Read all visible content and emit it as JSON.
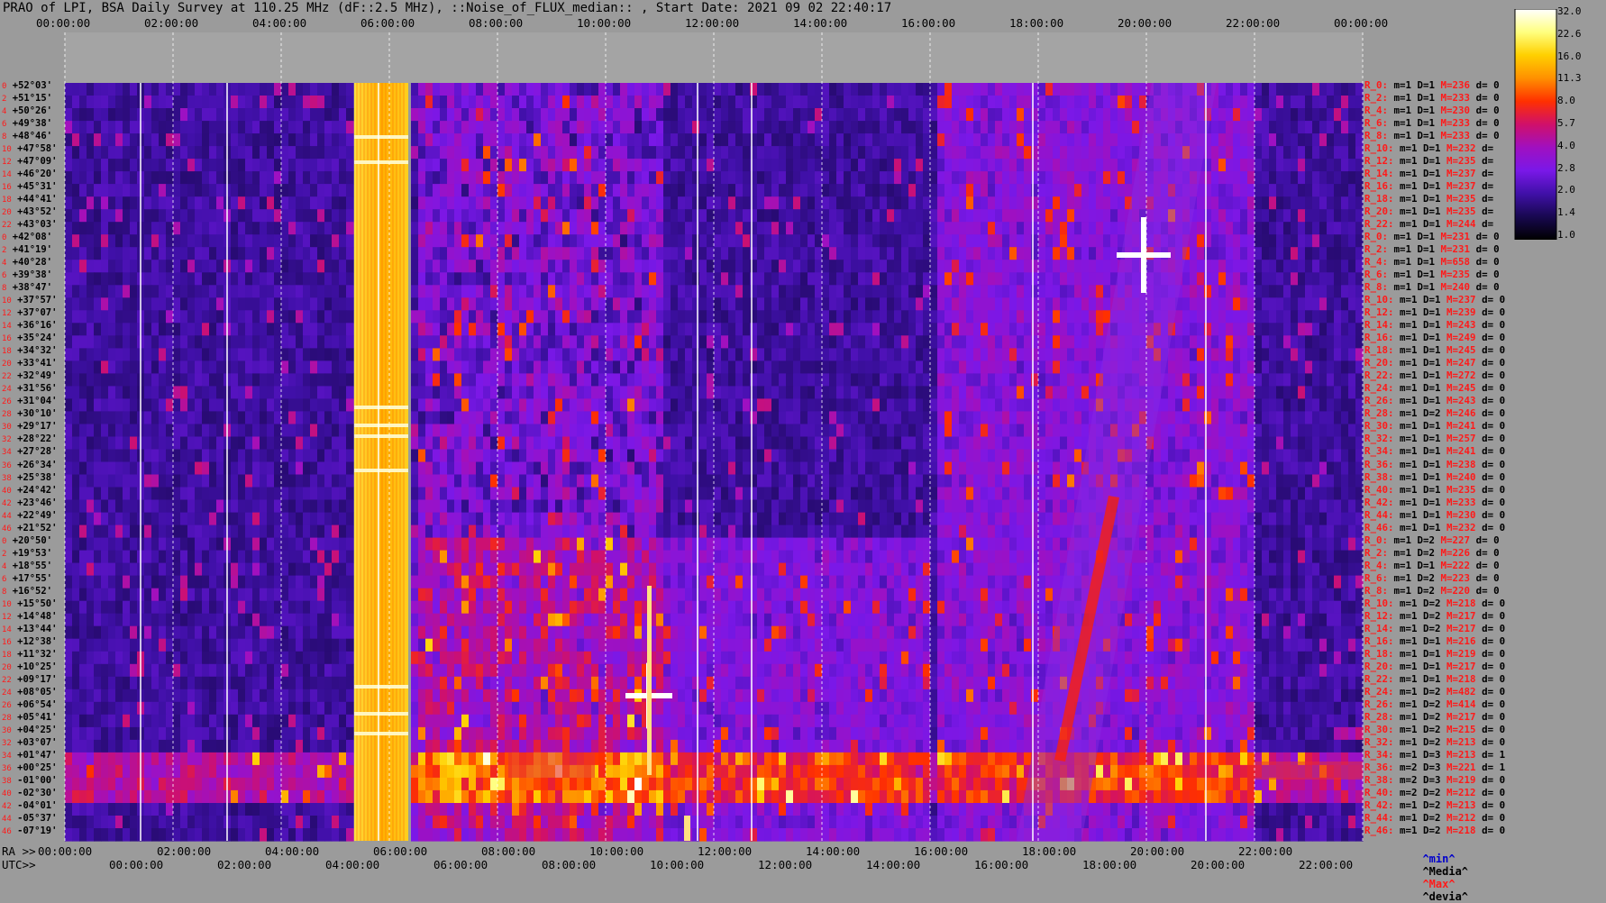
{
  "title": "PRAO of LPI, BSA Daily Survey at 110.25 MHz (dF::2.5 MHz), ::Noise_of_FLUX_median:: , Start Date: 2021 09 02 22:40:17",
  "top_axis": [
    "00:00:00",
    "02:00:00",
    "04:00:00",
    "06:00:00",
    "08:00:00",
    "10:00:00",
    "12:00:00",
    "14:00:00",
    "16:00:00",
    "18:00:00",
    "20:00:00",
    "22:00:00",
    "00:00:00"
  ],
  "ra_prefix": "RA >>",
  "ra_axis": [
    "00:00:00",
    "02:00:00",
    "04:00:00",
    "06:00:00",
    "08:00:00",
    "10:00:00",
    "12:00:00",
    "14:00:00",
    "16:00:00",
    "18:00:00",
    "20:00:00",
    "22:00:00"
  ],
  "utc_prefix": "UTC>>",
  "utc_axis": [
    "00:00:00",
    "02:00:00",
    "04:00:00",
    "06:00:00",
    "08:00:00",
    "10:00:00",
    "12:00:00",
    "14:00:00",
    "16:00:00",
    "18:00:00",
    "20:00:00",
    "22:00:00"
  ],
  "colorbar": {
    "ticks": [
      "32.0",
      "22.6",
      "16.0",
      "11.3",
      "8.0",
      "5.7",
      "4.0",
      "2.8",
      "2.0",
      "1.4",
      "1.0"
    ],
    "colors": [
      "#ffffff",
      "#ffff80",
      "#ffd000",
      "#ff9000",
      "#ff3000",
      "#d0106a",
      "#a010c0",
      "#7a18e8",
      "#4010a8",
      "#180850",
      "#000000"
    ]
  },
  "legend": {
    "min": "^min^",
    "median": "^Media^",
    "max": "^Max^",
    "dev": "^devia^"
  },
  "legend_colors": {
    "min": "#0000cc",
    "median": "#000000",
    "max": "#ff1a1a",
    "dev": "#000000"
  },
  "chart_data": {
    "type": "heatmap",
    "title": "PRAO of LPI, BSA Daily Survey at 110.25 MHz (dF::2.5 MHz), ::Noise_of_FLUX_median:: , Start Date: 2021 09 02 22:40:17",
    "x_unit": "RA / UTC (hh:mm:ss)",
    "y_labels": [
      "+52°03'",
      "+51°15'",
      "+50°26'",
      "+49°38'",
      "+48°46'",
      "+47°58'",
      "+47°09'",
      "+46°20'",
      "+45°31'",
      "+44°41'",
      "+43°52'",
      "+43°03'",
      "+42°08'",
      "+41°19'",
      "+40°28'",
      "+39°38'",
      "+38°47'",
      "+37°57'",
      "+37°07'",
      "+36°16'",
      "+35°24'",
      "+34°32'",
      "+33°41'",
      "+32°49'",
      "+31°56'",
      "+31°04'",
      "+30°10'",
      "+29°17'",
      "+28°22'",
      "+27°28'",
      "+26°34'",
      "+25°38'",
      "+24°42'",
      "+23°46'",
      "+22°49'",
      "+21°52'",
      "+20°50'",
      "+19°53'",
      "+18°55'",
      "+17°55'",
      "+16°52'",
      "+15°50'",
      "+14°48'",
      "+13°44'",
      "+12°38'",
      "+11°32'",
      "+10°25'",
      "+09°17'",
      "+08°05'",
      "+06°54'",
      "+05°41'",
      "+04°25'",
      "+03°07'",
      "+01°47'",
      "+00°25'",
      "-01°00'",
      "-02°30'",
      "-04°01'",
      "-05°37'",
      "-07°19'"
    ],
    "row_numbers": [
      "0",
      "2",
      "4",
      "6",
      "8",
      "10",
      "12",
      "14",
      "16",
      "18",
      "20",
      "22",
      "0",
      "2",
      "4",
      "6",
      "8",
      "10",
      "12",
      "14",
      "16",
      "18",
      "20",
      "22",
      "24",
      "26",
      "28",
      "30",
      "32",
      "34",
      "36",
      "38",
      "40",
      "42",
      "44",
      "46",
      "0",
      "2",
      "4",
      "6",
      "8",
      "10",
      "12",
      "14",
      "16",
      "18",
      "20",
      "22",
      "24",
      "26",
      "28",
      "30",
      "32",
      "34",
      "36",
      "38",
      "40",
      "42",
      "44",
      "46"
    ],
    "colorbar_range": [
      1.0,
      32.0
    ],
    "colorbar_scale": "log"
  },
  "row_stats": [
    {
      "r": "R_0:",
      "m": "m=1",
      "D": "D=1",
      "M": "M=236",
      "d": "d= 0"
    },
    {
      "r": "R_2:",
      "m": "m=1",
      "D": "D=1",
      "M": "M=233",
      "d": "d= 0"
    },
    {
      "r": "R_4:",
      "m": "m=1",
      "D": "D=1",
      "M": "M=230",
      "d": "d= 0"
    },
    {
      "r": "R_6:",
      "m": "m=1",
      "D": "D=1",
      "M": "M=233",
      "d": "d= 0"
    },
    {
      "r": "R_8:",
      "m": "m=1",
      "D": "D=1",
      "M": "M=233",
      "d": "d= 0"
    },
    {
      "r": "R_10:",
      "m": "m=1",
      "D": "D=1",
      "M": "M=232",
      "d": "d="
    },
    {
      "r": "R_12:",
      "m": "m=1",
      "D": "D=1",
      "M": "M=235",
      "d": "d="
    },
    {
      "r": "R_14:",
      "m": "m=1",
      "D": "D=1",
      "M": "M=237",
      "d": "d="
    },
    {
      "r": "R_16:",
      "m": "m=1",
      "D": "D=1",
      "M": "M=237",
      "d": "d="
    },
    {
      "r": "R_18:",
      "m": "m=1",
      "D": "D=1",
      "M": "M=235",
      "d": "d="
    },
    {
      "r": "R_20:",
      "m": "m=1",
      "D": "D=1",
      "M": "M=235",
      "d": "d="
    },
    {
      "r": "R_22:",
      "m": "m=1",
      "D": "D=1",
      "M": "M=244",
      "d": "d="
    },
    {
      "r": "R_0:",
      "m": "m=1",
      "D": "D=1",
      "M": "M=231",
      "d": "d= 0"
    },
    {
      "r": "R_2:",
      "m": "m=1",
      "D": "D=1",
      "M": "M=231",
      "d": "d= 0"
    },
    {
      "r": "R_4:",
      "m": "m=1",
      "D": "D=1",
      "M": "M=658",
      "d": "d= 0"
    },
    {
      "r": "R_6:",
      "m": "m=1",
      "D": "D=1",
      "M": "M=235",
      "d": "d= 0"
    },
    {
      "r": "R_8:",
      "m": "m=1",
      "D": "D=1",
      "M": "M=240",
      "d": "d= 0"
    },
    {
      "r": "R_10:",
      "m": "m=1",
      "D": "D=1",
      "M": "M=237",
      "d": "d= 0"
    },
    {
      "r": "R_12:",
      "m": "m=1",
      "D": "D=1",
      "M": "M=239",
      "d": "d= 0"
    },
    {
      "r": "R_14:",
      "m": "m=1",
      "D": "D=1",
      "M": "M=243",
      "d": "d= 0"
    },
    {
      "r": "R_16:",
      "m": "m=1",
      "D": "D=1",
      "M": "M=249",
      "d": "d= 0"
    },
    {
      "r": "R_18:",
      "m": "m=1",
      "D": "D=1",
      "M": "M=245",
      "d": "d= 0"
    },
    {
      "r": "R_20:",
      "m": "m=1",
      "D": "D=1",
      "M": "M=247",
      "d": "d= 0"
    },
    {
      "r": "R_22:",
      "m": "m=1",
      "D": "D=1",
      "M": "M=272",
      "d": "d= 0"
    },
    {
      "r": "R_24:",
      "m": "m=1",
      "D": "D=1",
      "M": "M=245",
      "d": "d= 0"
    },
    {
      "r": "R_26:",
      "m": "m=1",
      "D": "D=1",
      "M": "M=243",
      "d": "d= 0"
    },
    {
      "r": "R_28:",
      "m": "m=1",
      "D": "D=2",
      "M": "M=246",
      "d": "d= 0"
    },
    {
      "r": "R_30:",
      "m": "m=1",
      "D": "D=1",
      "M": "M=241",
      "d": "d= 0"
    },
    {
      "r": "R_32:",
      "m": "m=1",
      "D": "D=1",
      "M": "M=257",
      "d": "d= 0"
    },
    {
      "r": "R_34:",
      "m": "m=1",
      "D": "D=1",
      "M": "M=241",
      "d": "d= 0"
    },
    {
      "r": "R_36:",
      "m": "m=1",
      "D": "D=1",
      "M": "M=238",
      "d": "d= 0"
    },
    {
      "r": "R_38:",
      "m": "m=1",
      "D": "D=1",
      "M": "M=240",
      "d": "d= 0"
    },
    {
      "r": "R_40:",
      "m": "m=1",
      "D": "D=1",
      "M": "M=235",
      "d": "d= 0"
    },
    {
      "r": "R_42:",
      "m": "m=1",
      "D": "D=1",
      "M": "M=233",
      "d": "d= 0"
    },
    {
      "r": "R_44:",
      "m": "m=1",
      "D": "D=1",
      "M": "M=230",
      "d": "d= 0"
    },
    {
      "r": "R_46:",
      "m": "m=1",
      "D": "D=1",
      "M": "M=232",
      "d": "d= 0"
    },
    {
      "r": "R_0:",
      "m": "m=1",
      "D": "D=2",
      "M": "M=227",
      "d": "d= 0"
    },
    {
      "r": "R_2:",
      "m": "m=1",
      "D": "D=2",
      "M": "M=226",
      "d": "d= 0"
    },
    {
      "r": "R_4:",
      "m": "m=1",
      "D": "D=1",
      "M": "M=222",
      "d": "d= 0"
    },
    {
      "r": "R_6:",
      "m": "m=1",
      "D": "D=2",
      "M": "M=223",
      "d": "d= 0"
    },
    {
      "r": "R_8:",
      "m": "m=1",
      "D": "D=2",
      "M": "M=220",
      "d": "d= 0"
    },
    {
      "r": "R_10:",
      "m": "m=1",
      "D": "D=2",
      "M": "M=218",
      "d": "d= 0"
    },
    {
      "r": "R_12:",
      "m": "m=1",
      "D": "D=2",
      "M": "M=217",
      "d": "d= 0"
    },
    {
      "r": "R_14:",
      "m": "m=1",
      "D": "D=2",
      "M": "M=217",
      "d": "d= 0"
    },
    {
      "r": "R_16:",
      "m": "m=1",
      "D": "D=1",
      "M": "M=216",
      "d": "d= 0"
    },
    {
      "r": "R_18:",
      "m": "m=1",
      "D": "D=1",
      "M": "M=219",
      "d": "d= 0"
    },
    {
      "r": "R_20:",
      "m": "m=1",
      "D": "D=1",
      "M": "M=217",
      "d": "d= 0"
    },
    {
      "r": "R_22:",
      "m": "m=1",
      "D": "D=1",
      "M": "M=218",
      "d": "d= 0"
    },
    {
      "r": "R_24:",
      "m": "m=1",
      "D": "D=2",
      "M": "M=482",
      "d": "d= 0"
    },
    {
      "r": "R_26:",
      "m": "m=1",
      "D": "D=2",
      "M": "M=414",
      "d": "d= 0"
    },
    {
      "r": "R_28:",
      "m": "m=1",
      "D": "D=2",
      "M": "M=217",
      "d": "d= 0"
    },
    {
      "r": "R_30:",
      "m": "m=1",
      "D": "D=2",
      "M": "M=215",
      "d": "d= 0"
    },
    {
      "r": "R_32:",
      "m": "m=1",
      "D": "D=2",
      "M": "M=213",
      "d": "d= 0"
    },
    {
      "r": "R_34:",
      "m": "m=1",
      "D": "D=3",
      "M": "M=213",
      "d": "d= 1"
    },
    {
      "r": "R_36:",
      "m": "m=2",
      "D": "D=3",
      "M": "M=221",
      "d": "d= 1"
    },
    {
      "r": "R_38:",
      "m": "m=2",
      "D": "D=3",
      "M": "M=219",
      "d": "d= 0"
    },
    {
      "r": "R_40:",
      "m": "m=2",
      "D": "D=2",
      "M": "M=212",
      "d": "d= 0"
    },
    {
      "r": "R_42:",
      "m": "m=1",
      "D": "D=2",
      "M": "M=213",
      "d": "d= 0"
    },
    {
      "r": "R_44:",
      "m": "m=1",
      "D": "D=2",
      "M": "M=212",
      "d": "d= 0"
    },
    {
      "r": "R_46:",
      "m": "m=1",
      "D": "D=2",
      "M": "M=218",
      "d": "d= 0"
    }
  ]
}
